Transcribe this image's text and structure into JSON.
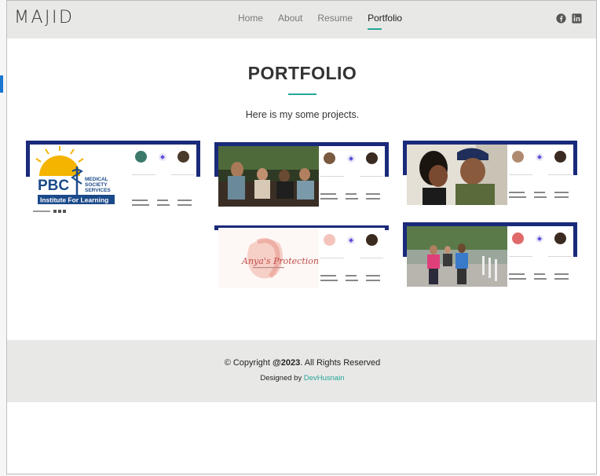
{
  "brand": {
    "logo": "MAJID"
  },
  "nav": {
    "items": [
      "Home",
      "About",
      "Resume",
      "Portfolio"
    ],
    "active": "Portfolio"
  },
  "social": {
    "icons": [
      "facebook-icon",
      "linkedin-icon"
    ]
  },
  "portfolio": {
    "title": "PORTFOLIO",
    "subtitle": "Here is my some projects.",
    "cards": [
      {
        "image": "pbc-medical-society-services-card"
      },
      {
        "image": "group-discussion-card"
      },
      {
        "image": "couple-photo-card"
      },
      {
        "image": "anyas-protection-inc-card"
      },
      {
        "image": "walking-group-card"
      }
    ]
  },
  "footer": {
    "copyright_prefix": "© Copyright ",
    "copyright_year": "@2023",
    "copyright_suffix": ". All Rights Reserved",
    "designed_prefix": "Designed by ",
    "designer": "DevHusnain"
  },
  "colors": {
    "accent": "#26a69a",
    "navbar_bg": "#e8e8e6",
    "card_band": "#1a2a7a"
  }
}
